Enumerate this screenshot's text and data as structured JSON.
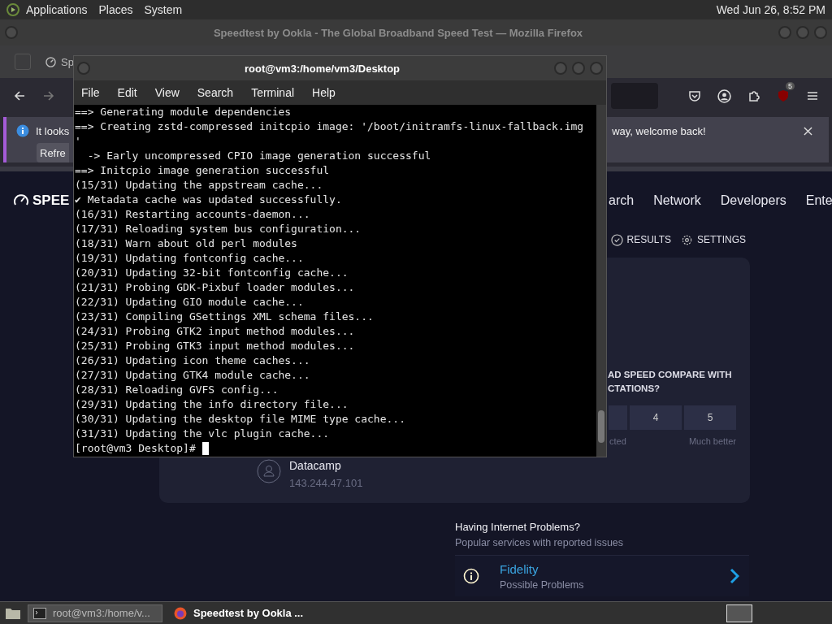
{
  "top_panel": {
    "menus": [
      "Applications",
      "Places",
      "System"
    ],
    "clock": "Wed Jun 26,  8:52 PM"
  },
  "browser": {
    "title": "Speedtest by Ookla - The Global Broadband Speed Test — Mozilla Firefox",
    "tab": "Sp",
    "extension_badge": "5",
    "notification": {
      "text_left": "It looks",
      "text_right": "way, welcome back!",
      "button": "Refre"
    },
    "page": {
      "logo": "SPEE",
      "nav": [
        "arch",
        "Network",
        "Developers",
        "Ente"
      ],
      "actions": [
        "RESULTS",
        "SETTINGS"
      ],
      "question": [
        "AD SPEED COMPARE WITH",
        "CTATIONS?"
      ],
      "ratings": [
        "4",
        "5"
      ],
      "scale_labels": [
        "cted",
        "Much better"
      ],
      "provider": {
        "name": "Datacamp",
        "ip": "143.244.47.101"
      },
      "problems": {
        "title": "Having Internet Problems?",
        "subtitle": "Popular services with reported issues",
        "items": [
          {
            "name": "Fidelity",
            "status": "Possible Problems"
          }
        ]
      }
    }
  },
  "terminal": {
    "title": "root@vm3:/home/vm3/Desktop",
    "menus": [
      "File",
      "Edit",
      "View",
      "Search",
      "Terminal",
      "Help"
    ],
    "lines": [
      "==> Generating module dependencies",
      "==> Creating zstd-compressed initcpio image: '/boot/initramfs-linux-fallback.img",
      "'",
      "  -> Early uncompressed CPIO image generation successful",
      "==> Initcpio image generation successful",
      "(15/31) Updating the appstream cache...",
      "✔ Metadata cache was updated successfully.",
      "(16/31) Restarting accounts-daemon...",
      "(17/31) Reloading system bus configuration...",
      "(18/31) Warn about old perl modules",
      "(19/31) Updating fontconfig cache...",
      "(20/31) Updating 32-bit fontconfig cache...",
      "(21/31) Probing GDK-Pixbuf loader modules...",
      "(22/31) Updating GIO module cache...",
      "(23/31) Compiling GSettings XML schema files...",
      "(24/31) Probing GTK2 input method modules...",
      "(25/31) Probing GTK3 input method modules...",
      "(26/31) Updating icon theme caches...",
      "(27/31) Updating GTK4 module cache...",
      "(28/31) Reloading GVFS config...",
      "(29/31) Updating the info directory file...",
      "(30/31) Updating the desktop file MIME type cache...",
      "(31/31) Updating the vlc plugin cache..."
    ],
    "prompt": "[root@vm3 Desktop]#"
  },
  "taskbar": {
    "items": [
      {
        "kind": "terminal",
        "label": "root@vm3:/home/v...",
        "selected": true
      },
      {
        "kind": "browser",
        "label": "Speedtest by Ookla ...",
        "selected": false
      }
    ]
  }
}
